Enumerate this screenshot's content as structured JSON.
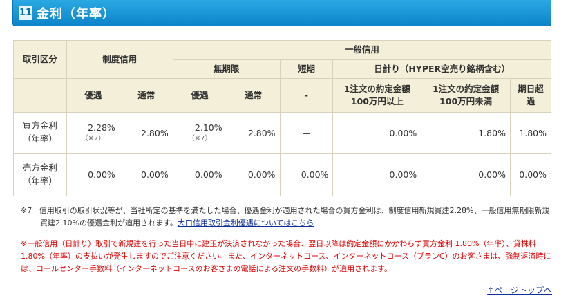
{
  "section": {
    "number": "11",
    "title": "金利（年率）"
  },
  "table": {
    "col_trade_type": "取引区分",
    "col_seido": "制度信用",
    "col_ippan": "一般信用",
    "col_mukigen": "無期限",
    "col_tanki": "短期",
    "col_hibakari": "日計り（HYPER空売り銘柄含む）",
    "sub": {
      "seido_yugu": "優遇",
      "seido_tsujo": "通常",
      "mukigen_yugu": "優遇",
      "mukigen_tsujo": "通常",
      "tanki_dash": "-",
      "over_1m_line1": "1注文の約定金額",
      "over_1m_line2": "100万円以上",
      "under_1m_line1": "1注文の約定金額",
      "under_1m_line2": "100万円未満",
      "overdue_line1": "期日超",
      "overdue_line2": "過"
    },
    "rows": [
      {
        "label_line1": "買方金利",
        "label_line2": "（年率）",
        "seido_yugu": "2.28%",
        "seido_yugu_note": "（※7）",
        "seido_tsujo": "2.80%",
        "mukigen_yugu": "2.10%",
        "mukigen_yugu_note": "（※7）",
        "mukigen_tsujo": "2.80%",
        "tanki": "－",
        "over_1m": "0.00%",
        "under_1m": "1.80%",
        "overdue": "1.80%"
      },
      {
        "label_line1": "売方金利",
        "label_line2": "（年率）",
        "seido_yugu": "0.00%",
        "seido_tsujo": "0.00%",
        "mukigen_yugu": "0.00%",
        "mukigen_tsujo": "0.00%",
        "tanki": "0.00%",
        "over_1m": "0.00%",
        "under_1m": "0.00%",
        "overdue": "0.00%"
      }
    ]
  },
  "footnote7": {
    "mark": "※7",
    "text": "信用取引の取引状況等が、当社所定の基準を満たした場合、優遇金利が適用された場合の買方金利は、制度信用新規買建2.28%、一般信用無期限新規買建2.10%の優遇金利が適用されます。",
    "link": "大口信用取引金利優遇についてはこちら"
  },
  "footnote_red": "※一般信用（日計り）取引で新規建を行った当日中に建玉が決済されなかった場合、翌日以降は約定金額にかかわらず買方金利 1.80%（年率）、貸株料 1.80%（年率）の支払いが発生しますのでご注意ください。また、インターネットコース、インターネットコース（プランC）のお客さまは、強制返済時には、コールセンター手数料（インターネットコースのお客さまの電話による注文の手数料）が適用されます。",
  "page_top": "↑ページトップへ",
  "colors": {
    "header_blue": "#0b84c9",
    "table_head_bg": "#f3efd8",
    "link": "#0d2f9f",
    "warning_red": "#e00000"
  }
}
